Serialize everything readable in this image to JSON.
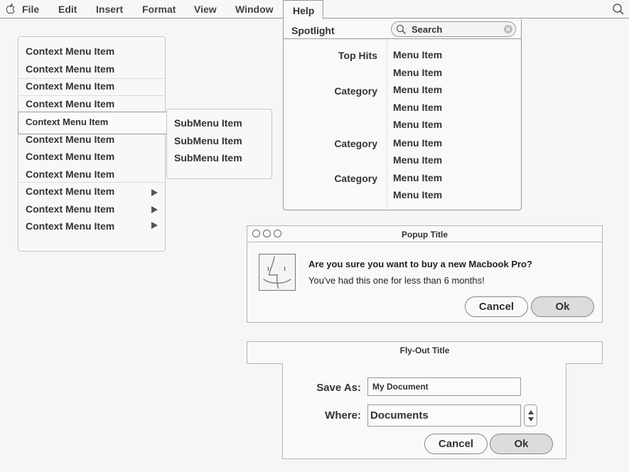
{
  "menubar": {
    "items": [
      "File",
      "Edit",
      "Insert",
      "Format",
      "View",
      "Window"
    ],
    "help": "Help"
  },
  "context_menu": {
    "items": [
      "Context Menu Item",
      "Context Menu Item",
      "Context Menu Item",
      "Context Menu Item",
      "Context Menu Item",
      "Context Menu Item",
      "Context Menu Item",
      "Context Menu Item",
      "Context Menu Item",
      "Context Menu Item",
      "Context Menu Item"
    ]
  },
  "submenu": {
    "items": [
      "SubMenu Item",
      "SubMenu Item",
      "SubMenu Item"
    ]
  },
  "spotlight": {
    "label": "Spotlight",
    "search_placeholder": "Search",
    "categories": [
      "Top Hits",
      "Category",
      "Category",
      "Category"
    ],
    "results": [
      "Menu Item",
      "Menu Item",
      "Menu Item",
      "Menu Item",
      "Menu Item",
      "Menu Item",
      "Menu Item",
      "Menu Item",
      "Menu Item"
    ]
  },
  "popup": {
    "title": "Popup Title",
    "heading": "Are you sure you want to buy a new Macbook Pro?",
    "message": "You've had this one for less than 6 months!",
    "cancel": "Cancel",
    "ok": "Ok"
  },
  "flyout": {
    "title": "Fly-Out Title",
    "save_as_label": "Save As:",
    "save_as_value": "My Document",
    "where_label": "Where:",
    "where_value": "Documents",
    "cancel": "Cancel",
    "ok": "Ok"
  },
  "colors": {
    "background": "#f6f6f6",
    "border": "#9a9a9a",
    "text": "#333333",
    "default_button": "#dcdcdc"
  }
}
